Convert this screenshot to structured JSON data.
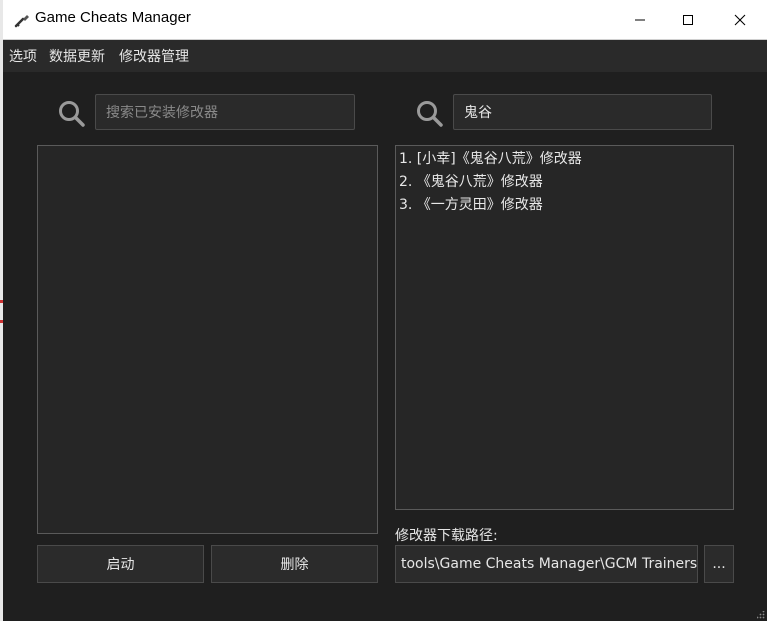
{
  "window": {
    "title": "Game Cheats Manager",
    "app_icon": "key-icon"
  },
  "window_controls": {
    "minimize": "minimize-icon",
    "maximize": "maximize-icon",
    "close": "close-icon"
  },
  "menu": {
    "items": [
      "选项",
      "数据更新",
      "修改器管理"
    ]
  },
  "installed": {
    "search": {
      "value": "",
      "placeholder": "搜索已安装修改器"
    },
    "items": []
  },
  "online": {
    "search": {
      "value": "鬼谷",
      "placeholder": ""
    },
    "results": [
      "1. [小幸]《鬼谷八荒》修改器",
      "2. 《鬼谷八荒》修改器",
      "3. 《一方灵田》修改器"
    ]
  },
  "actions": {
    "launch_label": "启动",
    "delete_label": "删除"
  },
  "download": {
    "label": "修改器下载路径:",
    "path": "tools\\Game Cheats Manager\\GCM Trainers",
    "browse_label": "..."
  },
  "colors": {
    "background": "#1f1f1f",
    "menubar": "#2a2a2a",
    "panel": "#262626",
    "border": "#5a5a5a",
    "text": "#e6e6e6"
  }
}
